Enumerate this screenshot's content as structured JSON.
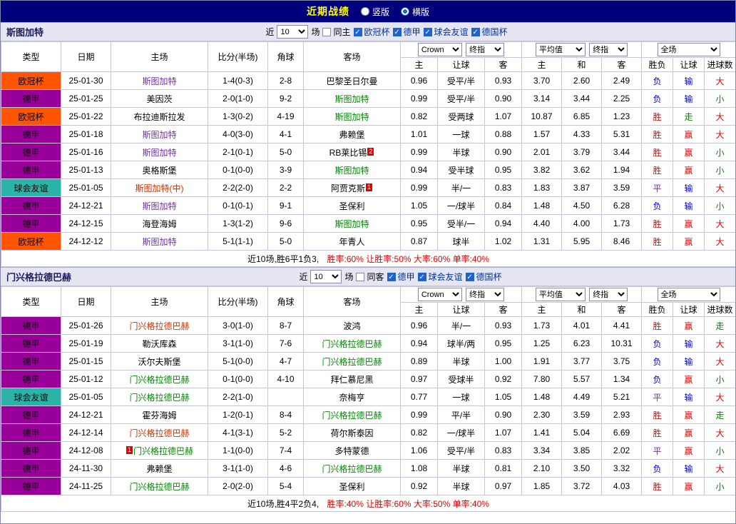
{
  "topbar": {
    "title": "近期战绩",
    "radio_vertical": "竖版",
    "radio_horizontal": "横版"
  },
  "columns": {
    "main": [
      "类型",
      "日期",
      "主场",
      "比分(半场)",
      "角球",
      "客场"
    ],
    "sub": [
      "主",
      "让球",
      "客",
      "主",
      "和",
      "客",
      "胜负",
      "让球",
      "进球数"
    ],
    "selects": {
      "company": "Crown",
      "final1": "终指",
      "average": "平均值",
      "final2": "终指",
      "fulltime": "全场"
    }
  },
  "colors": {
    "topbar_bg": "#00007d",
    "title": "#ffff00",
    "score": "#e60000",
    "type_colors": {
      "欧冠杯": "#ff5500",
      "德甲": "#990099",
      "球会友谊": "#2ab3a6"
    },
    "result_colors": {
      "胜": "#e60000",
      "平": "#7030a0",
      "负": "#0000d0",
      "赢": "#e60000",
      "输": "#0000d0",
      "走": "#008800",
      "大": "#e60000",
      "小": "#008800"
    }
  },
  "sections": [
    {
      "team": "斯图加特",
      "filter": {
        "near": "近",
        "count": "10",
        "games": "场",
        "venue": "同主",
        "venue_checked": false,
        "leagues": [
          "欧冠杯",
          "德甲",
          "球会友谊",
          "德国杯"
        ]
      },
      "rows": [
        {
          "type": "欧冠杯",
          "date": "25-01-30",
          "home": "斯图加特",
          "home_color": "#7030a0",
          "score": "1-4(0-3)",
          "corners": "2-8",
          "away": "巴黎圣日尔曼",
          "w_home": "0.96",
          "line": "受平/半",
          "w_away": "0.93",
          "avg_home": "3.70",
          "avg_draw": "2.60",
          "avg_away": "2.49",
          "r_result": "负",
          "r_line": "输",
          "r_goals": "大"
        },
        {
          "type": "德甲",
          "date": "25-01-25",
          "home": "美因茨",
          "score": "2-0(1-0)",
          "corners": "9-2",
          "away": "斯图加特",
          "away_color": "#008800",
          "w_home": "0.99",
          "line": "受平/半",
          "w_away": "0.90",
          "avg_home": "3.14",
          "avg_draw": "3.44",
          "avg_away": "2.25",
          "r_result": "负",
          "r_line": "输",
          "r_goals": "小"
        },
        {
          "type": "欧冠杯",
          "date": "25-01-22",
          "home": "布拉迪斯拉发",
          "score": "1-3(0-2)",
          "corners": "4-19",
          "away": "斯图加特",
          "away_color": "#008800",
          "w_home": "0.82",
          "line": "受两球",
          "w_away": "1.07",
          "avg_home": "10.87",
          "avg_draw": "6.85",
          "avg_away": "1.23",
          "r_result": "胜",
          "r_line": "走",
          "r_goals": "大"
        },
        {
          "type": "德甲",
          "date": "25-01-18",
          "home": "斯图加特",
          "home_color": "#7030a0",
          "score": "4-0(3-0)",
          "corners": "4-1",
          "away": "弗赖堡",
          "w_home": "1.01",
          "line": "一球",
          "w_away": "0.88",
          "avg_home": "1.57",
          "avg_draw": "4.33",
          "avg_away": "5.31",
          "r_result": "胜",
          "r_line": "赢",
          "r_goals": "大"
        },
        {
          "type": "德甲",
          "date": "25-01-16",
          "home": "斯图加特",
          "home_color": "#7030a0",
          "score": "2-1(0-1)",
          "corners": "5-0",
          "away": "RB莱比锡",
          "away_badge": "2",
          "w_home": "0.99",
          "line": "半球",
          "w_away": "0.90",
          "avg_home": "2.01",
          "avg_draw": "3.79",
          "avg_away": "3.44",
          "r_result": "胜",
          "r_line": "赢",
          "r_goals": "小"
        },
        {
          "type": "德甲",
          "date": "25-01-13",
          "home": "奥格斯堡",
          "score": "0-1(0-0)",
          "corners": "3-9",
          "away": "斯图加特",
          "away_color": "#008800",
          "w_home": "0.94",
          "line": "受半球",
          "w_away": "0.95",
          "avg_home": "3.82",
          "avg_draw": "3.62",
          "avg_away": "1.94",
          "r_result": "胜",
          "r_line": "赢",
          "r_goals": "小"
        },
        {
          "type": "球会友谊",
          "date": "25-01-05",
          "home": "斯图加特(中)",
          "home_color": "#cc3300",
          "score": "2-2(2-0)",
          "corners": "2-2",
          "away": "阿贾克斯",
          "away_badge": "1",
          "w_home": "0.99",
          "line": "半/一",
          "w_away": "0.83",
          "avg_home": "1.83",
          "avg_draw": "3.87",
          "avg_away": "3.59",
          "r_result": "平",
          "r_line": "输",
          "r_goals": "大"
        },
        {
          "type": "德甲",
          "date": "24-12-21",
          "home": "斯图加特",
          "home_color": "#7030a0",
          "score": "0-1(0-1)",
          "corners": "9-1",
          "away": "圣保利",
          "w_home": "1.05",
          "line": "一/球半",
          "w_away": "0.84",
          "avg_home": "1.48",
          "avg_draw": "4.50",
          "avg_away": "6.28",
          "r_result": "负",
          "r_line": "输",
          "r_goals": "小"
        },
        {
          "type": "德甲",
          "date": "24-12-15",
          "home": "海登海姆",
          "score": "1-3(1-2)",
          "corners": "9-6",
          "away": "斯图加特",
          "away_color": "#008800",
          "w_home": "0.95",
          "line": "受半/一",
          "w_away": "0.94",
          "avg_home": "4.40",
          "avg_draw": "4.00",
          "avg_away": "1.73",
          "r_result": "胜",
          "r_line": "赢",
          "r_goals": "大"
        },
        {
          "type": "欧冠杯",
          "date": "24-12-12",
          "home": "斯图加特",
          "home_color": "#7030a0",
          "score": "5-1(1-1)",
          "corners": "5-0",
          "away": "年青人",
          "w_home": "0.87",
          "line": "球半",
          "w_away": "1.02",
          "avg_home": "1.31",
          "avg_draw": "5.95",
          "avg_away": "8.46",
          "r_result": "胜",
          "r_line": "赢",
          "r_goals": "大"
        }
      ],
      "summary_intro": "近10场,胜6平1负3,",
      "summary_rates": "胜率:60% 让胜率:50% 大率:60% 单率:40%"
    },
    {
      "team": "门兴格拉德巴赫",
      "filter": {
        "near": "近",
        "count": "10",
        "games": "场",
        "venue": "同客",
        "venue_checked": false,
        "leagues": [
          "德甲",
          "球会友谊",
          "德国杯"
        ]
      },
      "rows": [
        {
          "type": "德甲",
          "date": "25-01-26",
          "home": "门兴格拉德巴赫",
          "home_color": "#cc3300",
          "score": "3-0(1-0)",
          "corners": "8-7",
          "away": "波鸿",
          "w_home": "0.96",
          "line": "半/一",
          "w_away": "0.93",
          "avg_home": "1.73",
          "avg_draw": "4.01",
          "avg_away": "4.41",
          "r_result": "胜",
          "r_line": "赢",
          "r_goals": "走"
        },
        {
          "type": "德甲",
          "date": "25-01-19",
          "home": "勒沃库森",
          "score": "3-1(1-0)",
          "corners": "7-6",
          "away": "门兴格拉德巴赫",
          "away_color": "#008800",
          "w_home": "0.94",
          "line": "球半/两",
          "w_away": "0.95",
          "avg_home": "1.25",
          "avg_draw": "6.23",
          "avg_away": "10.31",
          "r_result": "负",
          "r_line": "输",
          "r_goals": "大"
        },
        {
          "type": "德甲",
          "date": "25-01-15",
          "home": "沃尔夫斯堡",
          "score": "5-1(0-0)",
          "corners": "4-7",
          "away": "门兴格拉德巴赫",
          "away_color": "#008800",
          "w_home": "0.89",
          "line": "半球",
          "w_away": "1.00",
          "avg_home": "1.91",
          "avg_draw": "3.77",
          "avg_away": "3.75",
          "r_result": "负",
          "r_line": "输",
          "r_goals": "大"
        },
        {
          "type": "德甲",
          "date": "25-01-12",
          "home": "门兴格拉德巴赫",
          "home_color": "#008800",
          "score": "0-1(0-0)",
          "corners": "4-10",
          "away": "拜仁慕尼黑",
          "w_home": "0.97",
          "line": "受球半",
          "w_away": "0.92",
          "avg_home": "7.80",
          "avg_draw": "5.57",
          "avg_away": "1.34",
          "r_result": "负",
          "r_line": "赢",
          "r_goals": "小"
        },
        {
          "type": "球会友谊",
          "date": "25-01-05",
          "home": "门兴格拉德巴赫",
          "home_color": "#008800",
          "score": "2-2(1-0)",
          "corners": "",
          "away": "奈梅亨",
          "w_home": "0.77",
          "line": "一球",
          "w_away": "1.05",
          "avg_home": "1.48",
          "avg_draw": "4.49",
          "avg_away": "5.21",
          "r_result": "平",
          "r_line": "输",
          "r_goals": "大"
        },
        {
          "type": "德甲",
          "date": "24-12-21",
          "home": "霍芬海姆",
          "score": "1-2(0-1)",
          "corners": "8-4",
          "away": "门兴格拉德巴赫",
          "away_color": "#008800",
          "w_home": "0.99",
          "line": "平/半",
          "w_away": "0.90",
          "avg_home": "2.30",
          "avg_draw": "3.59",
          "avg_away": "2.93",
          "r_result": "胜",
          "r_line": "赢",
          "r_goals": "走"
        },
        {
          "type": "德甲",
          "date": "24-12-14",
          "home": "门兴格拉德巴赫",
          "home_color": "#cc3300",
          "score": "4-1(3-1)",
          "corners": "5-2",
          "away": "荷尔斯泰因",
          "w_home": "0.82",
          "line": "一/球半",
          "w_away": "1.07",
          "avg_home": "1.41",
          "avg_draw": "5.04",
          "avg_away": "6.69",
          "r_result": "胜",
          "r_line": "赢",
          "r_goals": "大"
        },
        {
          "type": "德甲",
          "date": "24-12-08",
          "home": "门兴格拉德巴赫",
          "home_color": "#008800",
          "home_badge": "1",
          "score": "1-1(0-0)",
          "corners": "7-4",
          "away": "多特蒙德",
          "w_home": "1.06",
          "line": "受平/半",
          "w_away": "0.83",
          "avg_home": "3.34",
          "avg_draw": "3.85",
          "avg_away": "2.02",
          "r_result": "平",
          "r_line": "赢",
          "r_goals": "小"
        },
        {
          "type": "德甲",
          "date": "24-11-30",
          "home": "弗赖堡",
          "score": "3-1(1-0)",
          "corners": "4-6",
          "away": "门兴格拉德巴赫",
          "away_color": "#008800",
          "w_home": "1.08",
          "line": "半球",
          "w_away": "0.81",
          "avg_home": "2.10",
          "avg_draw": "3.50",
          "avg_away": "3.32",
          "r_result": "负",
          "r_line": "输",
          "r_goals": "大"
        },
        {
          "type": "德甲",
          "date": "24-11-25",
          "home": "门兴格拉德巴赫",
          "home_color": "#008800",
          "score": "2-0(2-0)",
          "corners": "5-4",
          "away": "圣保利",
          "w_home": "0.92",
          "line": "半球",
          "w_away": "0.97",
          "avg_home": "1.85",
          "avg_draw": "3.72",
          "avg_away": "4.03",
          "r_result": "胜",
          "r_line": "赢",
          "r_goals": "小"
        }
      ],
      "summary_intro": "近10场,胜4平2负4,",
      "summary_rates": "胜率:40% 让胜率:60% 大率:50% 单率:40%"
    }
  ]
}
